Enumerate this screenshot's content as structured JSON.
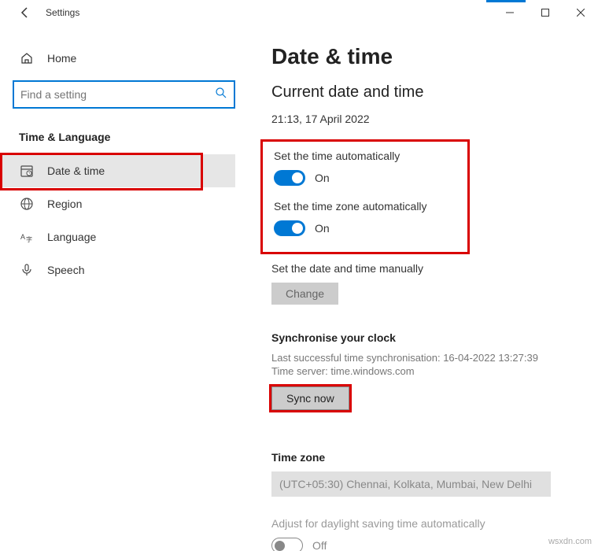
{
  "window": {
    "title": "Settings"
  },
  "sidebar": {
    "home_label": "Home",
    "search_placeholder": "Find a setting",
    "category": "Time & Language",
    "items": [
      {
        "label": "Date & time"
      },
      {
        "label": "Region"
      },
      {
        "label": "Language"
      },
      {
        "label": "Speech"
      }
    ]
  },
  "page": {
    "title": "Date & time",
    "subtitle": "Current date and time",
    "current_datetime": "21:13, 17 April 2022",
    "auto_time_label": "Set the time automatically",
    "auto_time_state": "On",
    "auto_tz_label": "Set the time zone automatically",
    "auto_tz_state": "On",
    "manual_label": "Set the date and time manually",
    "change_btn": "Change",
    "sync_title": "Synchronise your clock",
    "sync_last": "Last successful time synchronisation: 16-04-2022 13:27:39",
    "sync_server": "Time server: time.windows.com",
    "sync_btn": "Sync now",
    "tz_title": "Time zone",
    "tz_value": "(UTC+05:30) Chennai, Kolkata, Mumbai, New Delhi",
    "dst_label": "Adjust for daylight saving time automatically",
    "dst_state": "Off"
  },
  "watermark": "wsxdn.com"
}
